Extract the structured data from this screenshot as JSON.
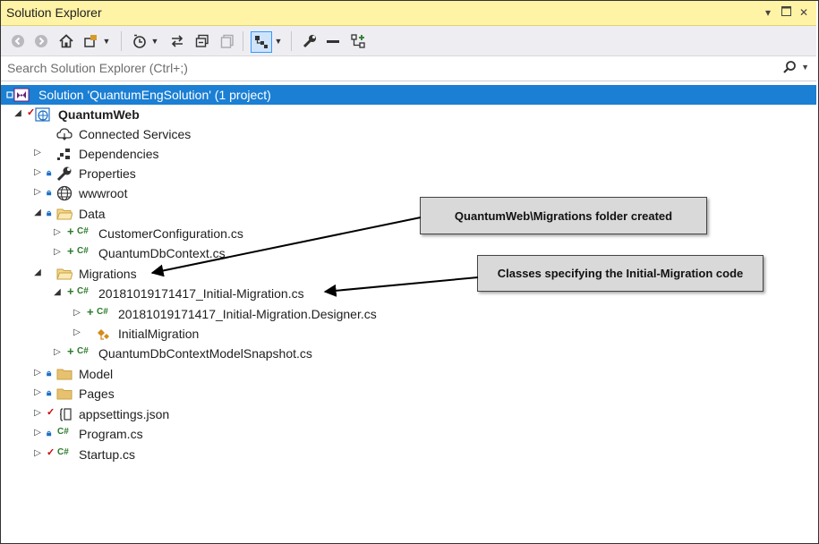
{
  "window": {
    "title": "Solution Explorer"
  },
  "search": {
    "placeholder": "Search Solution Explorer (Ctrl+;)"
  },
  "toolbar": {
    "icons": [
      "back-icon",
      "forward-icon",
      "home-icon",
      "switch-views-icon",
      "dropdown-icon",
      "pending-changes-filter-icon",
      "dropdown-icon",
      "sync-icon",
      "collapse-all-icon",
      "show-all-files-icon",
      "preview-selected-icon",
      "dropdown-icon",
      "properties-icon",
      "minus-icon",
      "class-view-icon"
    ]
  },
  "tree": {
    "solution": "Solution 'QuantumEngSolution' (1 project)",
    "project": "QuantumWeb",
    "items": [
      "Connected Services",
      "Dependencies",
      "Properties",
      "wwwroot",
      "Data",
      "CustomerConfiguration.cs",
      "QuantumDbContext.cs",
      "Migrations",
      "20181019171417_Initial-Migration.cs",
      "20181019171417_Initial-Migration.Designer.cs",
      "InitialMigration",
      "QuantumDbContextModelSnapshot.cs",
      "Model",
      "Pages",
      "appsettings.json",
      "Program.cs",
      "Startup.cs"
    ]
  },
  "callouts": {
    "migrations_folder": "QuantumWeb\\Migrations folder created",
    "initial_migration_classes": "Classes specifying the Initial-Migration code"
  },
  "colors": {
    "title_bar": "#fff3a6",
    "selection": "#1b7fd4",
    "callout_bg": "#d9d9d9",
    "added_green": "#2b7a2b",
    "checked_red": "#cc0000"
  }
}
